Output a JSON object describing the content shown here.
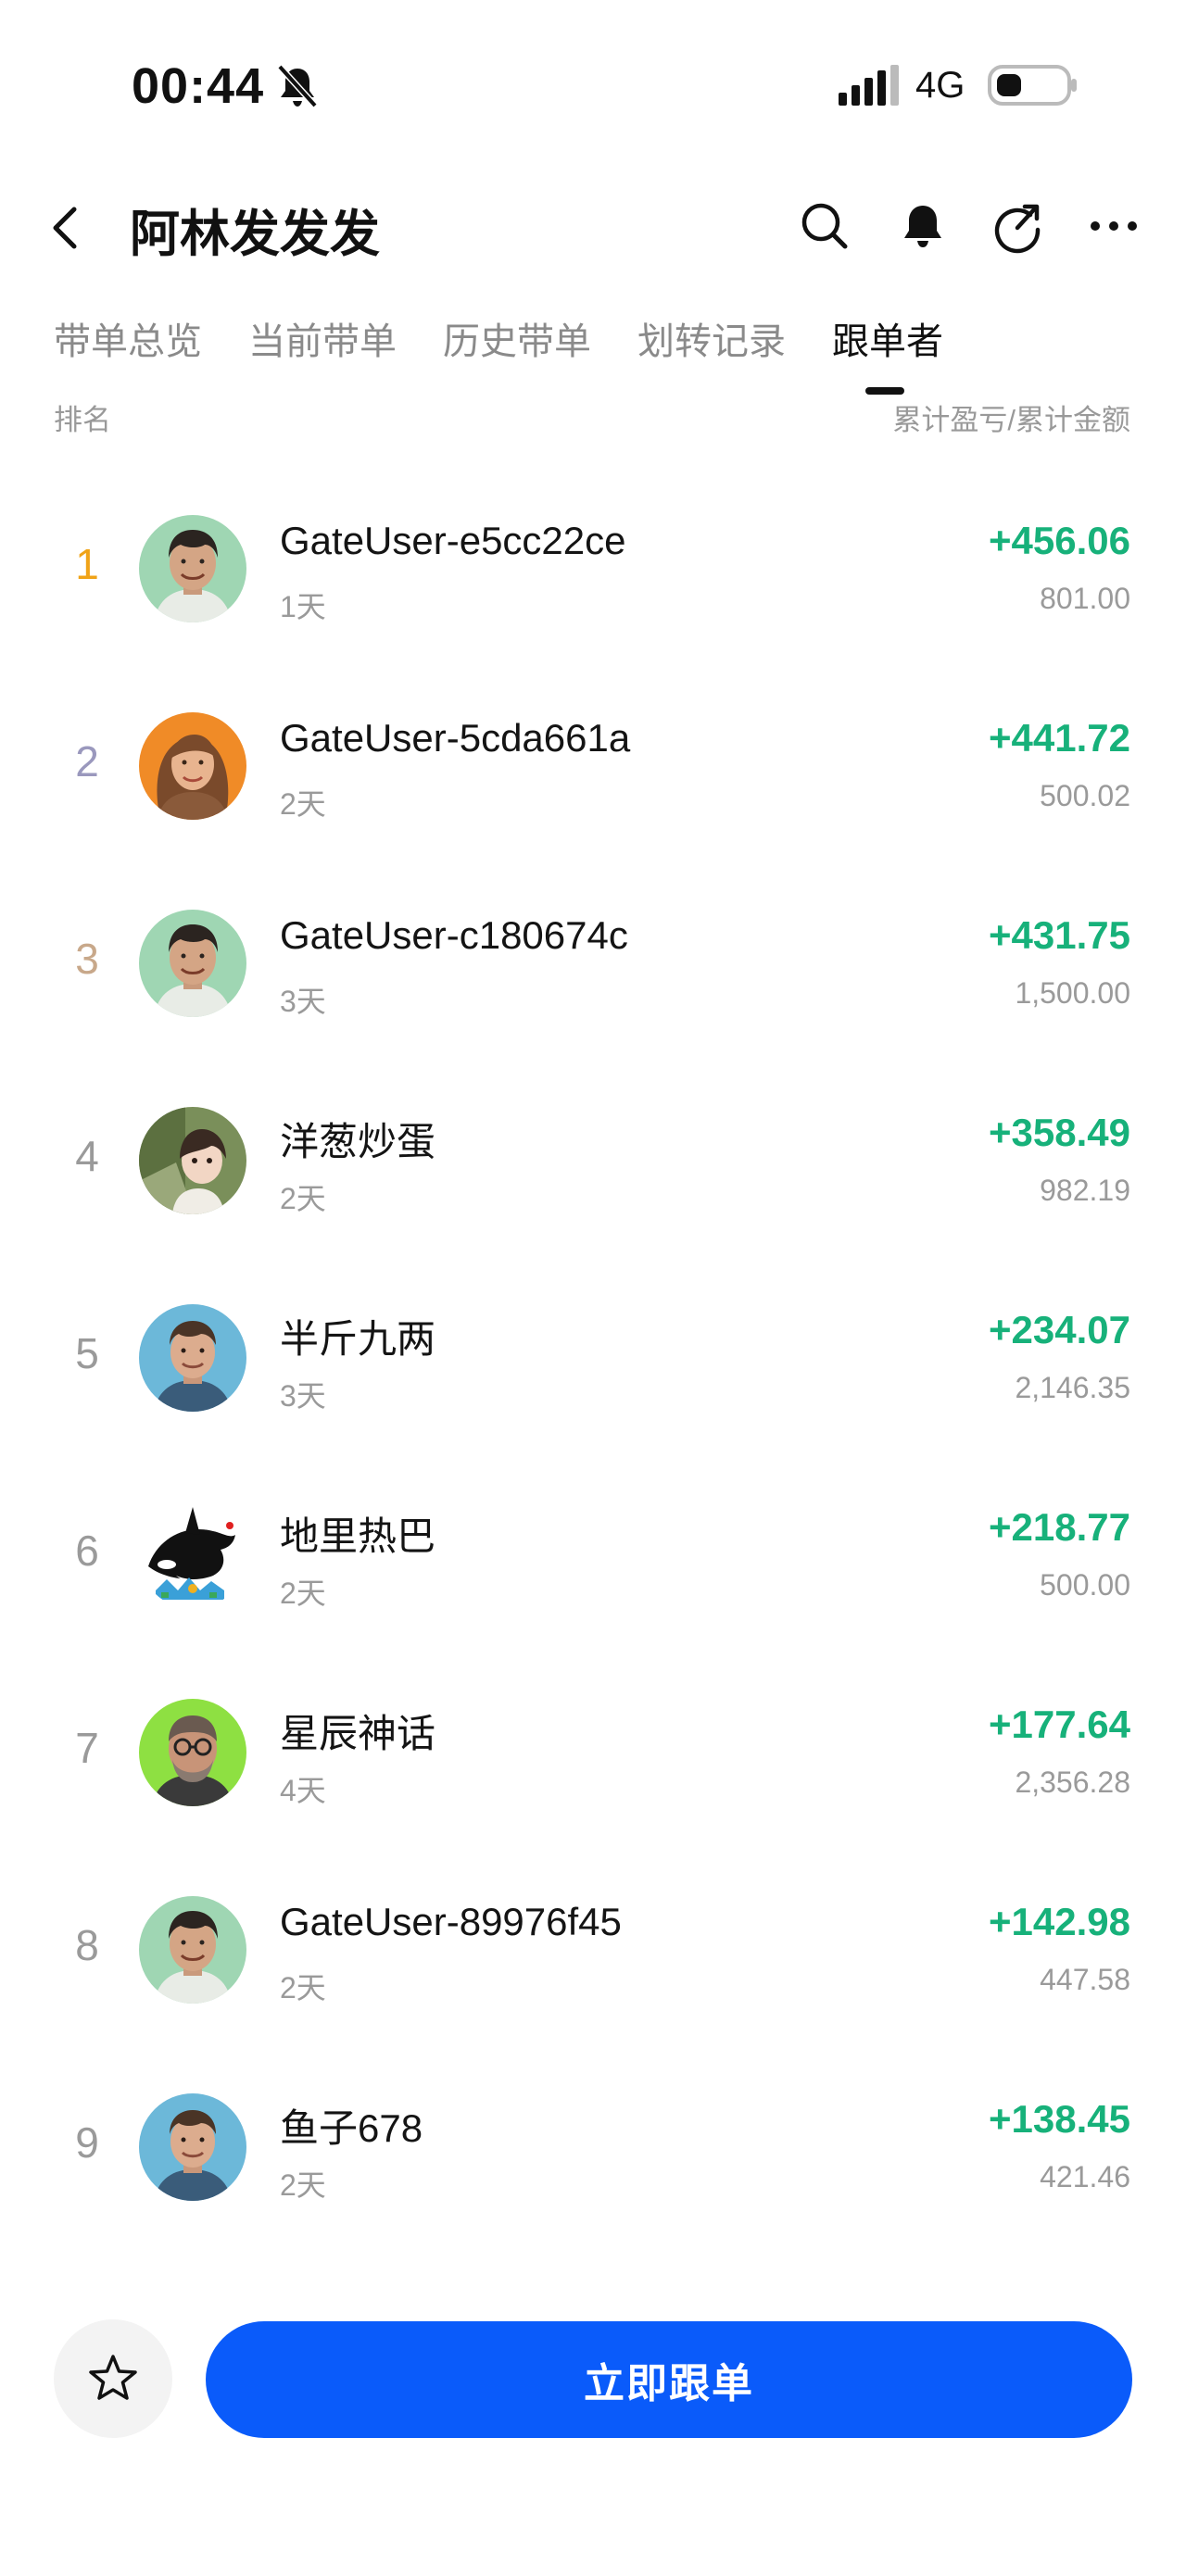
{
  "status_bar": {
    "time": "00:44",
    "network": "4G"
  },
  "header": {
    "title": "阿林发发发"
  },
  "tabs": [
    "带单总览",
    "当前带单",
    "历史带单",
    "划转记录",
    "跟单者"
  ],
  "columns": {
    "left": "排名",
    "right": "累计盈亏/累计金额"
  },
  "followers": [
    {
      "rank": "1",
      "name": "GateUser-e5cc22ce",
      "days": "1天",
      "pnl": "+456.06",
      "amount": "801.00",
      "avatar": "man-smile-green-bg"
    },
    {
      "rank": "2",
      "name": "GateUser-5cda661a",
      "days": "2天",
      "pnl": "+441.72",
      "amount": "500.02",
      "avatar": "woman-orange-bg"
    },
    {
      "rank": "3",
      "name": "GateUser-c180674c",
      "days": "3天",
      "pnl": "+431.75",
      "amount": "1,500.00",
      "avatar": "man-smile-green-bg"
    },
    {
      "rank": "4",
      "name": "洋葱炒蛋",
      "days": "2天",
      "pnl": "+358.49",
      "amount": "982.19",
      "avatar": "child-photo"
    },
    {
      "rank": "5",
      "name": "半斤九两",
      "days": "3天",
      "pnl": "+234.07",
      "amount": "2,146.35",
      "avatar": "man-blue-bg"
    },
    {
      "rank": "6",
      "name": "地里热巴",
      "days": "2天",
      "pnl": "+218.77",
      "amount": "500.00",
      "avatar": "orca"
    },
    {
      "rank": "7",
      "name": "星辰神话",
      "days": "4天",
      "pnl": "+177.64",
      "amount": "2,356.28",
      "avatar": "man-glasses-lime-bg"
    },
    {
      "rank": "8",
      "name": "GateUser-89976f45",
      "days": "2天",
      "pnl": "+142.98",
      "amount": "447.58",
      "avatar": "man-smile-green-bg"
    },
    {
      "rank": "9",
      "name": "鱼子678",
      "days": "2天",
      "pnl": "+138.45",
      "amount": "421.46",
      "avatar": "man-blue-bg"
    }
  ],
  "bottom_bar": {
    "follow_label": "立即跟单"
  },
  "colors": {
    "profit": "#17b17a",
    "primary": "#0a5bfa",
    "rank1": "#f0a317",
    "rank2": "#9a98bd",
    "rank3": "#c8a88a"
  }
}
